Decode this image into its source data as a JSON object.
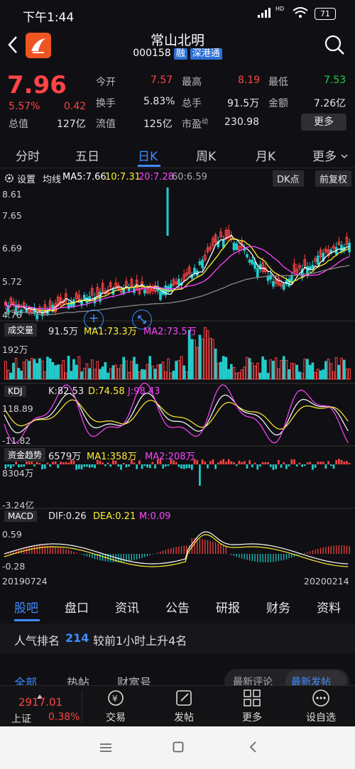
{
  "status": {
    "time": "下午1:44",
    "battery": "71"
  },
  "header": {
    "title": "常山北明",
    "code": "000158",
    "tag_margin": "融",
    "tag_connect": "深港通"
  },
  "quote": {
    "price": "7.96",
    "pct": "5.57%",
    "change": "0.42",
    "open_label": "今开",
    "open": "7.57",
    "high_label": "最高",
    "high": "8.19",
    "low_label": "最低",
    "low": "7.53",
    "turnover_label": "换手",
    "turnover": "5.83%",
    "vol_label": "总手",
    "vol": "91.5万",
    "amount_label": "金额",
    "amount": "7.26亿",
    "mktcap_label": "总值",
    "mktcap": "127亿",
    "float_label": "流值",
    "float": "125亿",
    "pe_label": "市盈",
    "pe_sup": "动",
    "pe": "230.98",
    "more_button": "更多"
  },
  "tabs": [
    "分时",
    "五日",
    "日K",
    "周K",
    "月K",
    "更多"
  ],
  "active_tab": 2,
  "kline_bar": {
    "settings": "设置",
    "ma_label": "均线",
    "ma5": "MA5:7.66",
    "ma10": "10:7.31",
    "ma20": "20:7.28",
    "ma60": "60:6.59",
    "dk_button": "DK点",
    "adjust_button": "前复权"
  },
  "colors": {
    "up": "#ff4444",
    "down": "#22cccc",
    "ma5": "#ffffff",
    "ma10": "#ffee33",
    "ma20": "#ff44ff",
    "ma60": "#888888"
  },
  "price_axis": [
    "8.61",
    "7.65",
    "6.69",
    "5.72",
    "4.76"
  ],
  "volume": {
    "label": "成交量",
    "value": "91.5万",
    "ma1": "MA1:73.3万",
    "ma2": "MA2:73.5万",
    "axis_top": "192万"
  },
  "kdj": {
    "label": "KDJ",
    "k": "K:82.53",
    "d": "D:74.58",
    "j": "J:98.43",
    "axis_top": "118.89",
    "axis_bottom": "-11.82"
  },
  "fund": {
    "label": "资金趋势",
    "value": "6579万",
    "ma1": "MA1:358万",
    "ma2": "MA2:208万",
    "axis_top": "8304万",
    "axis_bottom": "-3.24亿"
  },
  "macd": {
    "label": "MACD",
    "dif": "DIF:0.26",
    "dea": "DEA:0.21",
    "m": "M:0.09",
    "axis_top": "0.59",
    "axis_bottom": "-0.28"
  },
  "dates": {
    "start": "20190724",
    "end": "20200214"
  },
  "section_tabs": [
    "股吧",
    "盘口",
    "资讯",
    "公告",
    "研报",
    "财务",
    "资料"
  ],
  "popularity": {
    "prefix": "人气排名",
    "rank": "214",
    "suffix": "较前1小时上升4名"
  },
  "forum_tabs": [
    "全部",
    "热帖",
    "财富号"
  ],
  "forum_sort": [
    "最新评论",
    "最新发帖"
  ],
  "index": {
    "value": "2917.01",
    "name": "上证",
    "pct": "0.38%"
  },
  "nav": [
    "交易",
    "发帖",
    "更多",
    "设自选"
  ]
}
